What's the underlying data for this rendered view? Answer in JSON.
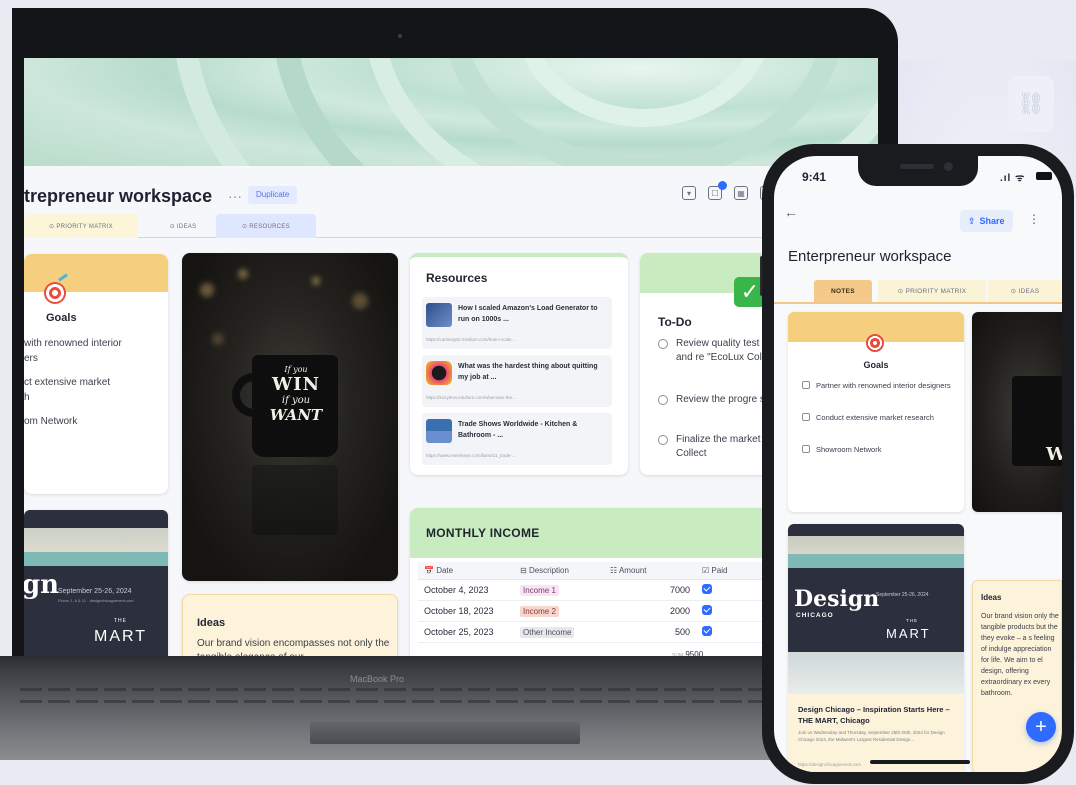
{
  "laptop": {
    "workspace_title": "trepreneur workspace",
    "more": "···",
    "duplicate_label": "Duplicate",
    "tabs": {
      "priority_matrix": "⊙ PRIORITY MATRIX",
      "ideas": "⊙ IDEAS",
      "resources": "⊙ RESOURCES"
    },
    "goals": {
      "title": "Goals",
      "items": [
        "with renowned interior",
        "ers",
        "ct extensive market",
        "h",
        "om Network"
      ]
    },
    "mug_text": {
      "line1": "If you",
      "line2": "WIN",
      "line3": "if you",
      "line4": "WANT"
    },
    "design": {
      "sn": "gn",
      "date": "September 25-26, 2024",
      "small": "Floors 1, 8 & 11 · designchicagoevent.com",
      "the": "THE",
      "mart": "MART"
    },
    "ideas": {
      "title": "Ideas",
      "text": "Our brand vision encompasses not only the tangible elegance of our"
    },
    "resources": {
      "title": "Resources",
      "items": [
        {
          "title": "How I scaled Amazon's Load Generator to run on 1000s ...",
          "url": "https://carlosrg02.medium.com/how-i-scale..."
        },
        {
          "title": "What was the hardest thing about quitting my job at ...",
          "url": "https://kozyrkov.medium.com/what-was-the..."
        },
        {
          "title": "Trade Shows Worldwide - Kitchen & Bathroom - ...",
          "url": "https://www.eventseye.com/fairs/st1_trade-..."
        }
      ]
    },
    "todo": {
      "title": "To-Do",
      "items": [
        "Review quality test procedures and re \"EcoLux Collection",
        "Review the progre showroom",
        "Finalize the market the 'EcoLux Collect"
      ]
    },
    "income": {
      "title": "MONTHLY INCOME",
      "columns": [
        "Date",
        "Description",
        "Amount",
        "Paid"
      ],
      "column_icons": [
        "📅",
        "⊟",
        "☷",
        "☑"
      ],
      "rows": [
        {
          "date": "October 4, 2023",
          "description": "Income 1",
          "amount": "7000",
          "paid": true
        },
        {
          "date": "October 18, 2023",
          "description": "Income 2",
          "amount": "2000",
          "paid": true
        },
        {
          "date": "October 25, 2023",
          "description": "Other Income",
          "amount": "500",
          "paid": true
        }
      ],
      "sum_label": "SUM",
      "sum_value": "9500"
    },
    "brand_label": "MacBook Pro"
  },
  "phone": {
    "time": "9:41",
    "status": ".ıl ᯤ",
    "back": "←",
    "share_label": "Share",
    "more": "⋮",
    "title": "Enterpreneur workspace",
    "tabs": {
      "notes": "NOTES",
      "priority_matrix": "⊙ PRIORITY MATRIX",
      "ideas": "⊙ IDEAS"
    },
    "goals": {
      "title": "Goals",
      "items": [
        "Partner with renowned interior designers",
        "Conduct extensive market research",
        "Showroom Network"
      ]
    },
    "design": {
      "name": "Design",
      "city": "CHICAGO",
      "date": "September 25-26, 2024",
      "the": "THE",
      "mart": "MART",
      "caption": "Design Chicago – Inspiration Starts Here – THE MART, Chicago",
      "body": "Join us Wednesday and Thursday, September 25th-26th, 2024 for Design Chicago 2024, the Midwest's Largest Residential Design...",
      "url": "https://designchicagoevent.com"
    },
    "ideas": {
      "title": "Ideas",
      "text": "Our brand vision only the tangible products but the they evoke – a s feeling of indulge appreciation for life. We aim to el design, offering extraordinary ex every bathroom."
    },
    "fab": "+"
  },
  "colors": {
    "accent": "#2f6bff",
    "goals_band": "#f5cf7e",
    "todo_band": "#c8ecbf",
    "ideas_bg": "#fdf3da",
    "laptop_body": "#141518"
  },
  "icons": [
    "target-icon",
    "checkmark-emoji-icon",
    "calendar-icon",
    "share-icon",
    "back-arrow-icon",
    "plus-icon",
    "link-icon"
  ]
}
